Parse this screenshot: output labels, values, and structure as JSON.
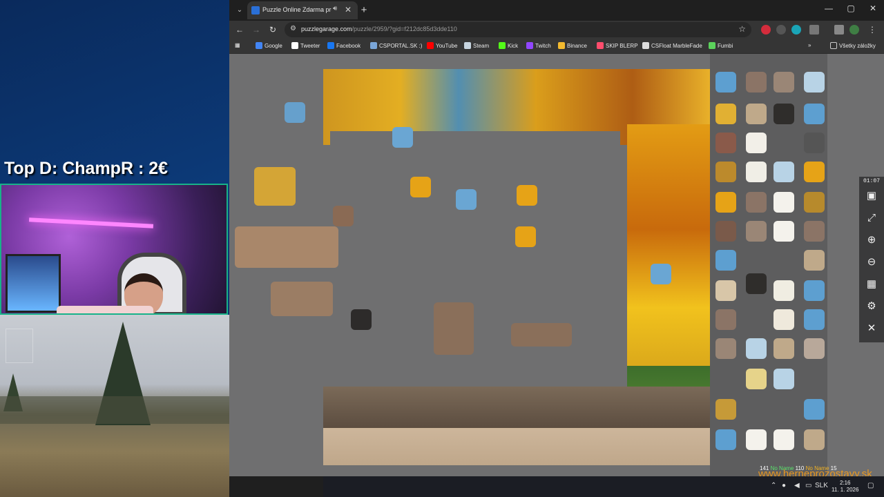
{
  "overlay": {
    "donation_text": "Top D: ChampR : 2€"
  },
  "browser": {
    "tab_title": "Puzzle Online Zdarma pre Každého",
    "new_tab_icon": "plus-icon",
    "window_controls": [
      "—",
      "▢",
      "✕"
    ],
    "url_host": "puzzlegarage.com",
    "url_path": "/puzzle/2959/?gid=f212dc85d3dde110",
    "bookmarks": [
      {
        "label": "Google",
        "color": "#4285f4"
      },
      {
        "label": "Tweeter",
        "color": "#ffffff"
      },
      {
        "label": "Facebook",
        "color": "#1877f2"
      },
      {
        "label": "CSPORTAL.SK :)",
        "color": "#7aa6d8"
      },
      {
        "label": "YouTube",
        "color": "#ff0000"
      },
      {
        "label": "Steam",
        "color": "#c7d5e0"
      },
      {
        "label": "Kick",
        "color": "#53fc18"
      },
      {
        "label": "Twitch",
        "color": "#9146ff"
      },
      {
        "label": "Binance",
        "color": "#f3ba2f"
      },
      {
        "label": "SKIP BLERP",
        "color": "#ff4d6d"
      },
      {
        "label": "CSFloat MarbleFade",
        "color": "#dddddd"
      },
      {
        "label": "Fumbi",
        "color": "#5bd25b"
      }
    ],
    "all_bookmarks_label": "Všetky záložky"
  },
  "puzzle": {
    "timer": "01:07",
    "tools": [
      {
        "name": "image-preview-icon",
        "glyph": "▣"
      },
      {
        "name": "fullscreen-icon",
        "glyph": "⤢"
      },
      {
        "name": "zoom-in-icon",
        "glyph": "⊕"
      },
      {
        "name": "zoom-out-icon",
        "glyph": "⊖"
      },
      {
        "name": "grid-icon",
        "glyph": "▦"
      },
      {
        "name": "settings-icon",
        "glyph": "⚙"
      },
      {
        "name": "close-icon",
        "glyph": "✕"
      }
    ],
    "status": {
      "count_a": "141",
      "name_a": "No Name",
      "count_b": "110",
      "name_b": "No Name",
      "count_c": "15"
    },
    "watermark": "www.herneprozostavy.sk"
  },
  "taskbar": {
    "language": "SLK",
    "time": "2:16",
    "date": "11. 1. 2026"
  }
}
